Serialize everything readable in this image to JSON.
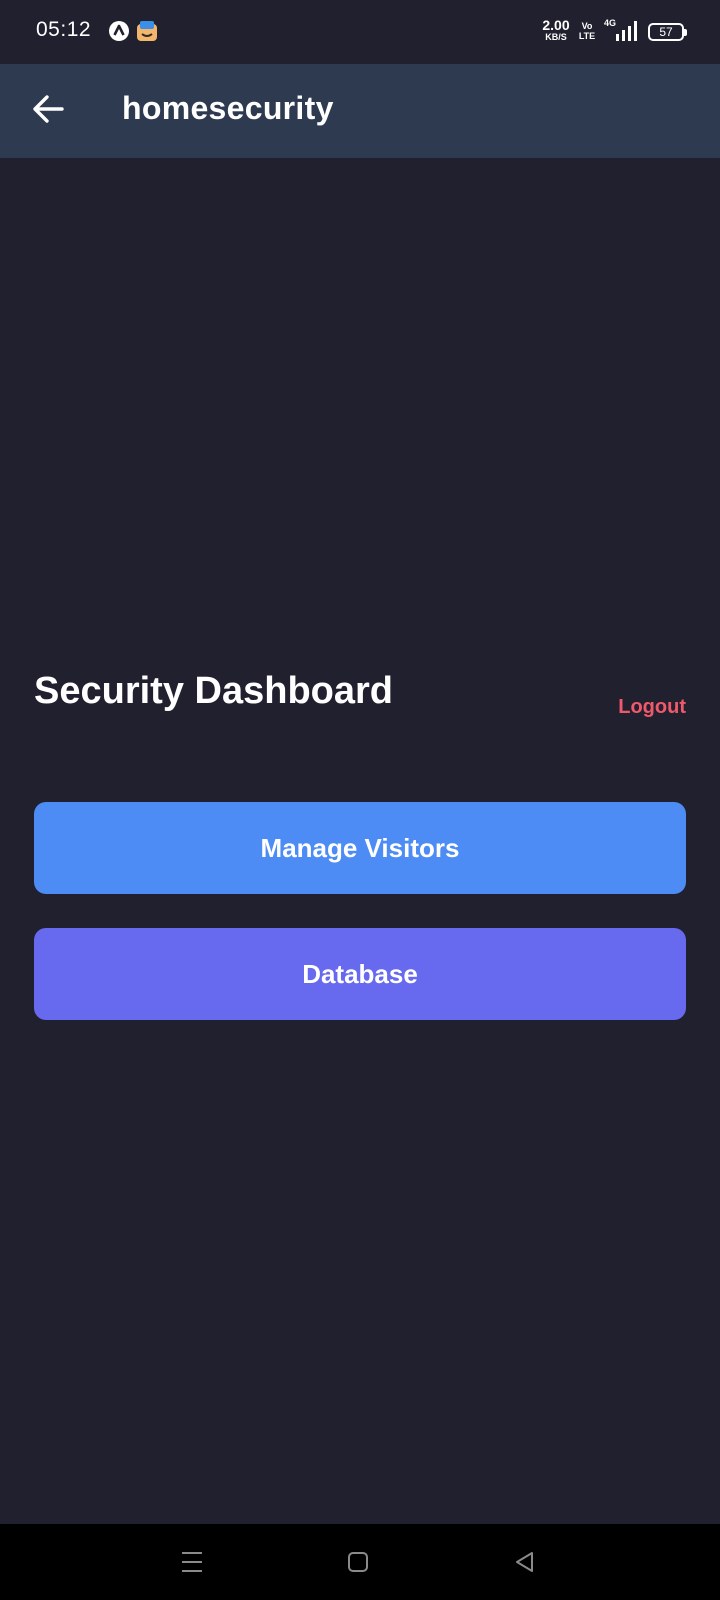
{
  "status_bar": {
    "time": "05:12",
    "net_speed_value": "2.00",
    "net_speed_unit": "KB/S",
    "volte_top": "Vo",
    "volte_bottom": "LTE",
    "network_type": "4G",
    "battery_level": "57"
  },
  "app_bar": {
    "title": "homesecurity",
    "back_icon": "arrow-left-icon"
  },
  "dashboard": {
    "title": "Security Dashboard",
    "logout_label": "Logout",
    "buttons": [
      {
        "label": "Manage Visitors",
        "color": "#4d8cf5"
      },
      {
        "label": "Database",
        "color": "#6769ee"
      }
    ]
  },
  "nav_bar": {
    "icons": [
      "menu-icon",
      "home-icon",
      "back-triangle-icon"
    ]
  },
  "colors": {
    "background": "#20202f",
    "app_bar": "#2e3a4f",
    "logout": "#f0596a"
  }
}
